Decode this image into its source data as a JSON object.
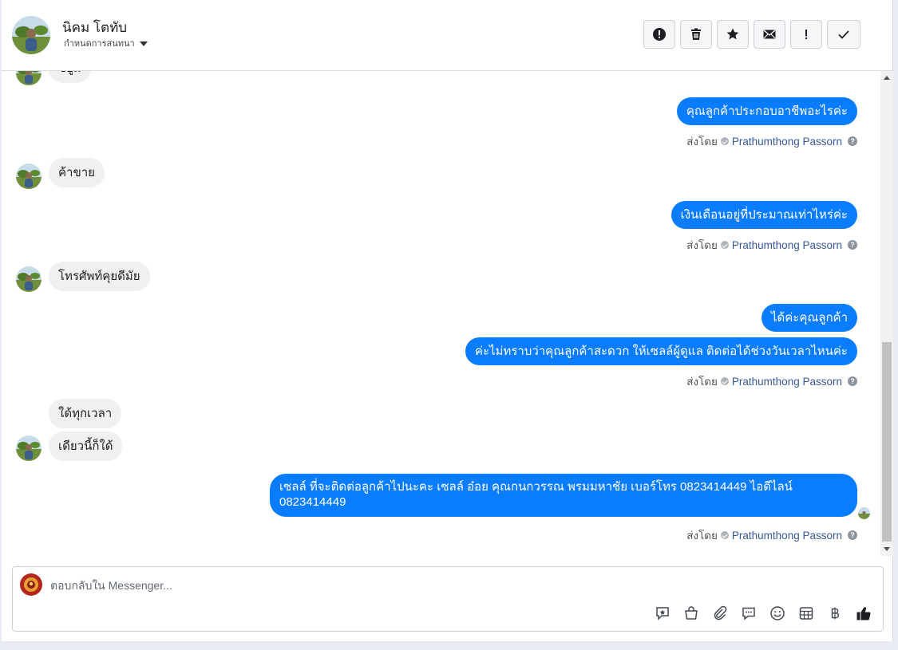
{
  "contact": {
    "name": "นิคม โตทับ",
    "status_label": "กำหนดการสนทนา"
  },
  "actions": [
    {
      "name": "spam-button",
      "icon": "alert-circle-icon"
    },
    {
      "name": "delete-button",
      "icon": "trash-icon"
    },
    {
      "name": "star-button",
      "icon": "star-icon"
    },
    {
      "name": "mark-unread-button",
      "icon": "envelope-icon"
    },
    {
      "name": "follow-up-button",
      "icon": "exclamation-icon"
    },
    {
      "name": "done-button",
      "icon": "check-icon"
    }
  ],
  "messages": {
    "m0": "ขยูม",
    "m1": "คุณลูกค้าประกอบอาชีพอะไรค่ะ",
    "m2": "ค้าขาย",
    "m3": "เงินเดือนอยู่ที่ประมาณเท่าไหร่ค่ะ",
    "m4": "โทรศัพท์คุยดีมัย",
    "m5": "ได้ค่ะคุณลูกค้า",
    "m6": "ค่ะไม่ทราบว่าคุณลูกค้าสะดวก ให้เซลล์ผู้ดูแล ติดต่อได้ช่วงวันเวลาไหนค่ะ",
    "m7": "ใด้ทุกเวลา",
    "m8": "เดียวนี้ก็ใด้",
    "m9": "เซลล์ ที่จะติดต่อลูกค้าไปนะคะ เซลล์ อ๋อย คุณกนกวรรณ พรมมหาชัย เบอร์โทร 0823414449 ไอดีไลน์ 0823414449"
  },
  "sent_by": {
    "prefix": "ส่งโดย",
    "agent": "Prathumthong Passorn"
  },
  "composer": {
    "placeholder": "ตอบกลับใน Messenger..."
  },
  "composer_tools": [
    "saved-reply-icon",
    "shopping-bag-icon",
    "paperclip-icon",
    "chat-bubble-icon",
    "emoji-icon",
    "calendar-grid-icon",
    "baht-icon",
    "thumbs-up-icon"
  ],
  "colors": {
    "outgoing": "#0a7cff",
    "incoming": "#f0f0f0",
    "agent_link": "#365899"
  }
}
